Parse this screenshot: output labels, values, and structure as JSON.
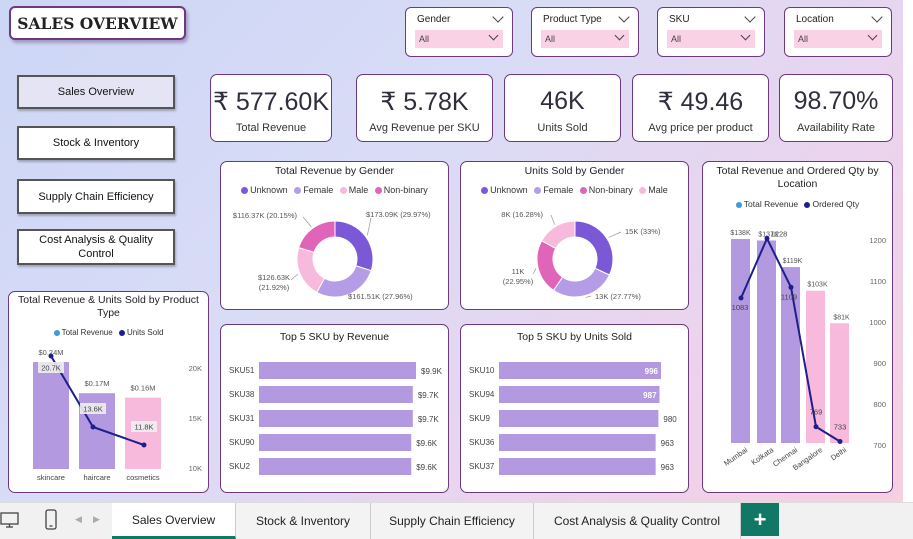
{
  "dashboard_title": "SALES OVERVIEW",
  "filters": [
    {
      "label": "Gender",
      "value": "All"
    },
    {
      "label": "Product Type",
      "value": "All"
    },
    {
      "label": "SKU",
      "value": "All"
    },
    {
      "label": "Location",
      "value": "All"
    }
  ],
  "nav_buttons": [
    {
      "label": "Sales Overview",
      "active": true
    },
    {
      "label": "Stock & Inventory"
    },
    {
      "label": "Supply Chain Efficiency"
    },
    {
      "label": "Cost Analysis & Quality Control"
    }
  ],
  "kpis": [
    {
      "value": "₹ 577.60K",
      "label": "Total Revenue"
    },
    {
      "value": "₹ 5.78K",
      "label": "Avg Revenue per SKU"
    },
    {
      "value": "46K",
      "label": "Units Sold"
    },
    {
      "value": "₹ 49.46",
      "label": "Avg price per product"
    },
    {
      "value": "98.70%",
      "label": "Availability Rate"
    }
  ],
  "colors": {
    "accent": "#6c3a7d",
    "unknown": "#7b58d6",
    "female": "#b49ce6",
    "male": "#f7b9dc",
    "nonbinary": "#e065b8",
    "bar": "#b39ae0",
    "line": "#1d1f8a",
    "tab_green": "#117865"
  },
  "chart_data": [
    {
      "type": "pie",
      "title": "Total Revenue by Gender",
      "legend": [
        "Unknown",
        "Female",
        "Male",
        "Non-binary"
      ],
      "slices": [
        {
          "name": "Unknown",
          "value": 173.09,
          "label": "$173.09K (29.97%)"
        },
        {
          "name": "Female",
          "value": 161.51,
          "label": "$161.51K (27.96%)"
        },
        {
          "name": "Male",
          "value": 126.63,
          "label": "$126.63K (21.92%)"
        },
        {
          "name": "Non-binary",
          "value": 116.37,
          "label": "$116.37K (20.15%)"
        }
      ]
    },
    {
      "type": "pie",
      "title": "Units Sold by Gender",
      "legend": [
        "Unknown",
        "Female",
        "Non-binary",
        "Male"
      ],
      "slices": [
        {
          "name": "Unknown",
          "value": 15,
          "label": "15K (33%)"
        },
        {
          "name": "Female",
          "value": 13,
          "label": "13K (27.77%)"
        },
        {
          "name": "Non-binary",
          "value": 11,
          "label": "11K (22.95%)"
        },
        {
          "name": "Male",
          "value": 8,
          "label": "8K (16.28%)"
        }
      ]
    },
    {
      "type": "bar",
      "title": "Top 5 SKU by Revenue",
      "categories": [
        "SKU51",
        "SKU38",
        "SKU31",
        "SKU90",
        "SKU2"
      ],
      "values": [
        9.9,
        9.7,
        9.7,
        9.6,
        9.6
      ],
      "value_labels": [
        "$9.9K",
        "$9.7K",
        "$9.7K",
        "$9.6K",
        "$9.6K"
      ]
    },
    {
      "type": "bar",
      "title": "Top 5 SKU by Units Sold",
      "categories": [
        "SKU10",
        "SKU94",
        "SKU9",
        "SKU36",
        "SKU37"
      ],
      "values": [
        996,
        987,
        980,
        963,
        963
      ],
      "value_labels": [
        "996",
        "987",
        "980",
        "963",
        "963"
      ]
    },
    {
      "type": "bar",
      "title": "Total Revenue & Units Sold by Product Type",
      "legend": [
        "Total Revenue",
        "Units Sold"
      ],
      "categories": [
        "skincare",
        "haircare",
        "cosmetics"
      ],
      "values": [
        0.24,
        0.17,
        0.16
      ],
      "value_labels": [
        "$0.24M",
        "$0.17M",
        "$0.16M"
      ],
      "line_values": [
        20.7,
        13.6,
        11.8
      ],
      "line_labels": [
        "20.7K",
        "13.6K",
        "11.8K"
      ],
      "y2_ticks": [
        "20K",
        "15K",
        "10K"
      ],
      "y2_range": [
        10,
        20
      ]
    },
    {
      "type": "bar",
      "title": "Total Revenue and Ordered Qty by Location",
      "legend": [
        "Total Revenue",
        "Ordered Qty"
      ],
      "categories": [
        "Mumbai",
        "Kolkata",
        "Chennai",
        "Bangalore",
        "Delhi"
      ],
      "values": [
        138,
        137,
        119,
        103,
        81
      ],
      "value_labels": [
        "$138K",
        "$137K",
        "$119K",
        "$103K",
        "$81K"
      ],
      "line_values": [
        1083,
        1228,
        1109,
        769,
        733
      ],
      "line_labels": [
        "1083",
        "1228",
        "1109",
        "769",
        "733"
      ],
      "y2_ticks": [
        "1200",
        "1100",
        "1000",
        "900",
        "800",
        "700"
      ],
      "y2_range": [
        700,
        1200
      ]
    }
  ],
  "tabs": [
    {
      "label": "Sales Overview",
      "active": true
    },
    {
      "label": "Stock & Inventory"
    },
    {
      "label": "Supply Chain Efficiency"
    },
    {
      "label": "Cost Analysis & Quality Control"
    }
  ],
  "add_tab_label": "+"
}
